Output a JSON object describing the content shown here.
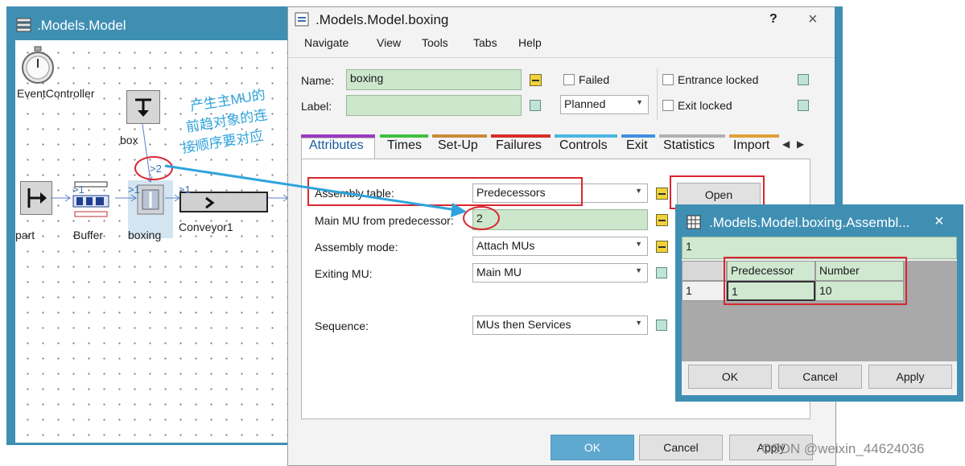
{
  "model_window": {
    "title": ".Models.Model",
    "objects": {
      "event_controller": "EventController",
      "box": "box",
      "part": "part",
      "buffer": "Buffer",
      "boxing": "boxing",
      "conveyor": "Conveyor1"
    },
    "connector_labels": [
      ">1",
      ">1",
      ">1",
      ">2"
    ]
  },
  "annotation": {
    "lines": [
      "产生主MU的",
      "前趋对象的连",
      "接顺序要对应"
    ]
  },
  "dialog": {
    "title": ".Models.Model.boxing",
    "help": "?",
    "close": "×",
    "menu": [
      "Navigate",
      "View",
      "Tools",
      "Tabs",
      "Help"
    ],
    "name_label": "Name:",
    "name_value": "boxing",
    "label_label": "Label:",
    "label_value": "",
    "failed": "Failed",
    "planned": "Planned",
    "entrance_locked": "Entrance locked",
    "exit_locked": "Exit locked",
    "tabs": [
      "Attributes",
      "Times",
      "Set-Up",
      "Failures",
      "Controls",
      "Exit",
      "Statistics",
      "Import"
    ],
    "tab_colors": [
      "#9b3bbf",
      "#3fbf3f",
      "#c88a3a",
      "#d92b2b",
      "#4ab8e0",
      "#3f8fe0",
      "#b0b0b0",
      "#e0a03a"
    ],
    "attributes": {
      "assembly_table_label": "Assembly table:",
      "assembly_table_value": "Predecessors",
      "open_button": "Open",
      "main_mu_label": "Main MU from predecessor:",
      "main_mu_value": "2",
      "assembly_mode_label": "Assembly mode:",
      "assembly_mode_value": "Attach MUs",
      "exiting_mu_label": "Exiting MU:",
      "exiting_mu_value": "Main MU",
      "sequence_label": "Sequence:",
      "sequence_value": "MUs then Services"
    },
    "buttons": {
      "ok": "OK",
      "cancel": "Cancel",
      "apply": "Apply"
    }
  },
  "assembly_window": {
    "title": ".Models.Model.boxing.Assembl...",
    "close": "×",
    "edit_value": "1",
    "columns": [
      "Predecessor",
      "Number"
    ],
    "rows": [
      {
        "index": "1",
        "predecessor": "1",
        "number": "10"
      }
    ],
    "buttons": {
      "ok": "OK",
      "cancel": "Cancel",
      "apply": "Apply"
    }
  },
  "watermark": "CSDN @weixin_44624036"
}
